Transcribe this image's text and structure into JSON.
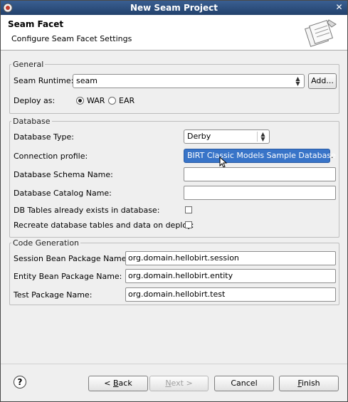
{
  "window": {
    "title": "New Seam Project"
  },
  "header": {
    "title": "Seam Facet",
    "subtitle": "Configure Seam Facet Settings"
  },
  "general": {
    "legend": "General",
    "runtime_label": "Seam Runtime:",
    "runtime_value": "seam",
    "add_label": "Add...",
    "deploy_label": "Deploy as:",
    "war_label": "WAR",
    "ear_label": "EAR"
  },
  "database": {
    "legend": "Database",
    "type_label": "Database Type:",
    "type_value": "Derby",
    "profile_label": "Connection profile:",
    "profile_value": "BIRT Classic Models Sample Database",
    "schema_label": "Database Schema Name:",
    "schema_value": "",
    "catalog_label": "Database Catalog Name:",
    "catalog_value": "",
    "tables_exist_label": "DB Tables already exists in database:",
    "recreate_label": "Recreate database tables and data on deploy:"
  },
  "codegen": {
    "legend": "Code Generation",
    "session_label": "Session Bean Package Name:",
    "session_value": "org.domain.hellobirt.session",
    "entity_label": "Entity Bean Package Name:",
    "entity_value": "org.domain.hellobirt.entity",
    "test_label": "Test Package Name:",
    "test_value": "org.domain.hellobirt.test"
  },
  "footer": {
    "help": "?",
    "back_prefix": "< ",
    "back_key": "B",
    "back_rest": "ack",
    "next_key": "N",
    "next_rest": "ext >",
    "cancel": "Cancel",
    "finish_key": "F",
    "finish_rest": "inish"
  }
}
